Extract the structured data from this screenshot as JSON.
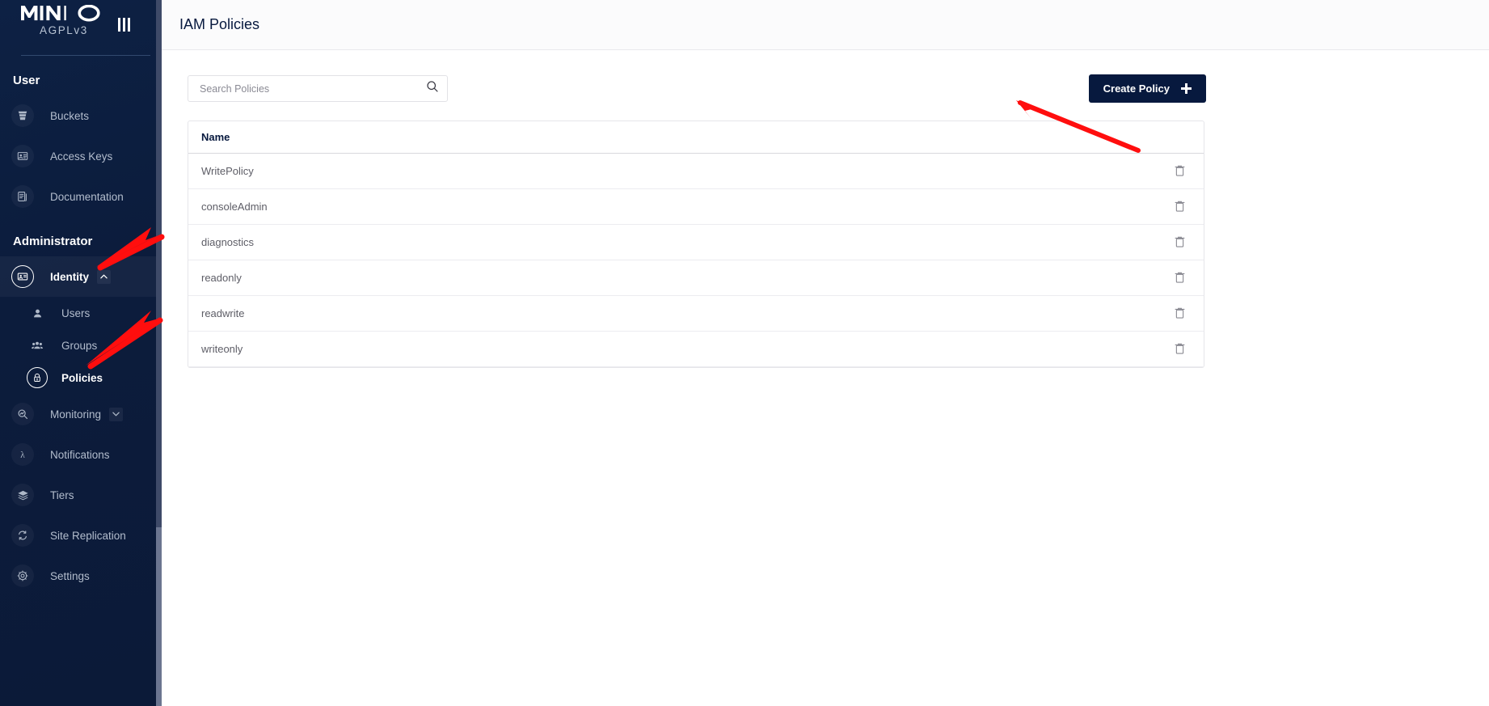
{
  "brand": {
    "name": "MINIO",
    "license": "AGPLv3",
    "collapse_icon": "menu-collapse-icon"
  },
  "sidebar": {
    "sections": [
      {
        "title": "User",
        "items": [
          {
            "label": "Buckets",
            "icon": "bucket-icon",
            "state": "normal"
          },
          {
            "label": "Access Keys",
            "icon": "access-key-icon",
            "state": "normal"
          },
          {
            "label": "Documentation",
            "icon": "documentation-icon",
            "state": "normal"
          }
        ]
      },
      {
        "title": "Administrator",
        "items": [
          {
            "label": "Identity",
            "icon": "identity-icon",
            "state": "expanded-parent",
            "chevron": "chevron-up-icon"
          },
          {
            "label": "Users",
            "icon": "user-icon",
            "state": "sub"
          },
          {
            "label": "Groups",
            "icon": "groups-icon",
            "state": "sub"
          },
          {
            "label": "Policies",
            "icon": "policy-lock-icon",
            "state": "sub-current"
          },
          {
            "label": "Monitoring",
            "icon": "monitoring-icon",
            "state": "normal",
            "chevron": "chevron-down-icon"
          },
          {
            "label": "Notifications",
            "icon": "lambda-icon",
            "state": "normal"
          },
          {
            "label": "Tiers",
            "icon": "tiers-icon",
            "state": "normal"
          },
          {
            "label": "Site Replication",
            "icon": "replication-icon",
            "state": "normal"
          },
          {
            "label": "Settings",
            "icon": "gear-icon",
            "state": "normal"
          }
        ]
      }
    ]
  },
  "header": {
    "title": "IAM Policies"
  },
  "toolbar": {
    "search_placeholder": "Search Policies",
    "search_value": "",
    "search_icon": "search-icon",
    "create_label": "Create Policy",
    "create_icon": "plus-icon"
  },
  "table": {
    "columns": [
      "Name",
      ""
    ],
    "rows": [
      {
        "name": "WritePolicy",
        "delete_icon": "trash-icon"
      },
      {
        "name": "consoleAdmin",
        "delete_icon": "trash-icon"
      },
      {
        "name": "diagnostics",
        "delete_icon": "trash-icon"
      },
      {
        "name": "readonly",
        "delete_icon": "trash-icon"
      },
      {
        "name": "readwrite",
        "delete_icon": "trash-icon"
      },
      {
        "name": "writeonly",
        "delete_icon": "trash-icon"
      }
    ]
  },
  "annotations": {
    "arrow_color": "#FF0E0E",
    "arrows": [
      {
        "name": "arrow-to-identity",
        "points_to": "Identity"
      },
      {
        "name": "arrow-to-policies",
        "points_to": "Policies"
      },
      {
        "name": "arrow-to-create-policy",
        "points_to": "Create Policy"
      }
    ]
  },
  "colors": {
    "sidebar_bg": "#0c1c3c",
    "accent_dark": "#07193e",
    "page_bg": "#ffffff",
    "muted_text": "#b3bdcd"
  }
}
